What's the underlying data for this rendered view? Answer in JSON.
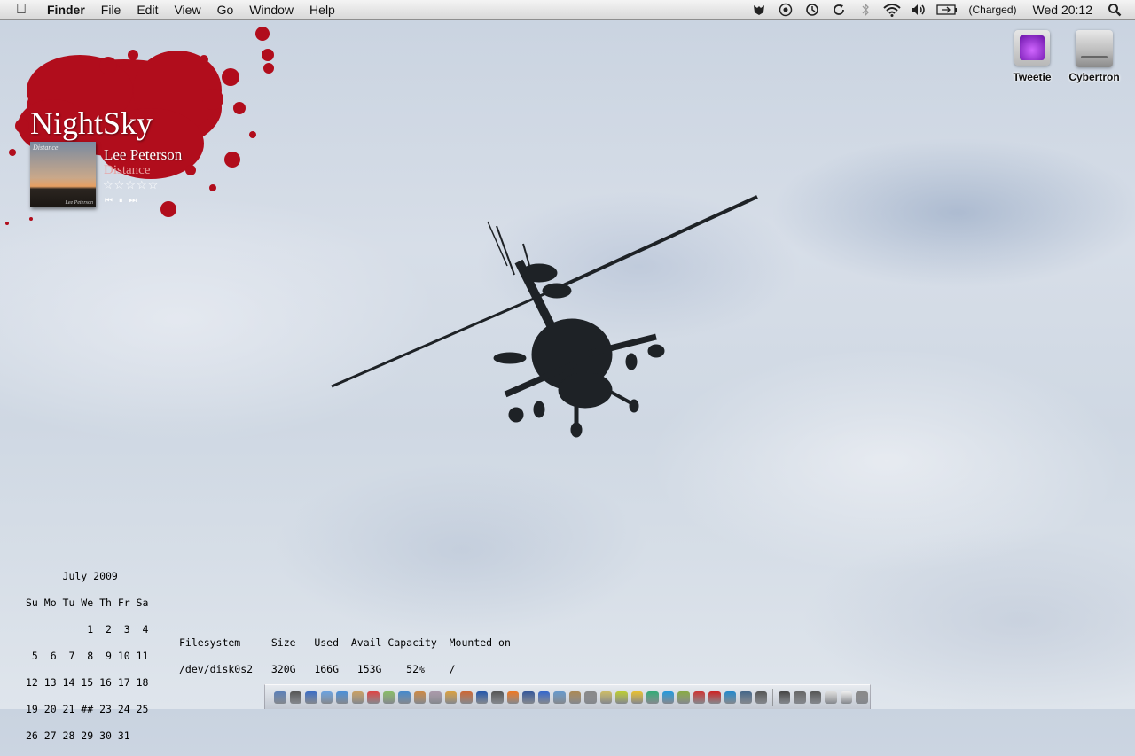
{
  "menubar": {
    "app_name": "Finder",
    "menus": [
      "File",
      "Edit",
      "View",
      "Go",
      "Window",
      "Help"
    ],
    "battery_status": "(Charged)",
    "clock": "Wed 20:12",
    "status_icons": [
      "growl-icon",
      "gear-icon",
      "time-machine-icon",
      "sync-icon",
      "bluetooth-icon",
      "wifi-icon",
      "volume-icon",
      "battery-icon",
      "spotlight-icon"
    ]
  },
  "desktop_icons": [
    {
      "label": "Tweetie",
      "icon": "tweetie-icon"
    },
    {
      "label": "Cybertron",
      "icon": "hard-drive-icon"
    }
  ],
  "nightsky": {
    "title": "NightSky",
    "album_title": "Distance",
    "album_artist_small": "Lee Peterson",
    "artist": "Lee Peterson",
    "song": "Distance",
    "rating": 0,
    "rating_max": 5,
    "stars_display": "☆☆☆☆☆",
    "controls": "⏮ ⏸ ⏭"
  },
  "calendar": {
    "header": "      July 2009",
    "weekdays": "Su Mo Tu We Th Fr Sa",
    "rows": [
      "          1  2  3  4",
      " 5  6  7  8  9 10 11",
      "12 13 14 15 16 17 18",
      "19 20 21 ## 23 24 25",
      "26 27 28 29 30 31"
    ]
  },
  "disk": {
    "header": "Filesystem     Size   Used  Avail Capacity  Mounted on",
    "row": "/dev/disk0s2   320G   166G   153G    52%    /"
  },
  "dock": {
    "colors": [
      "#5a7fb8",
      "#555",
      "#3a6cc4",
      "#6aa2e0",
      "#4a8fd8",
      "#c9a063",
      "#d44",
      "#8b6",
      "#4488cc",
      "#c84",
      "#a9a",
      "#d9a040",
      "#cc6633",
      "#2255aa",
      "#555",
      "#ee7722",
      "#335599",
      "#3366cc",
      "#6699cc",
      "#aa8855",
      "#888",
      "#ccbb66",
      "#bbcc33",
      "#e8c030",
      "#33aa77",
      "#2299dd",
      "#88aa44",
      "#cc3333",
      "#cc2222",
      "#2288cc",
      "#446688",
      "#555",
      "#444",
      "#666",
      "#555",
      "#ddd",
      "#eee",
      "#888"
    ]
  }
}
